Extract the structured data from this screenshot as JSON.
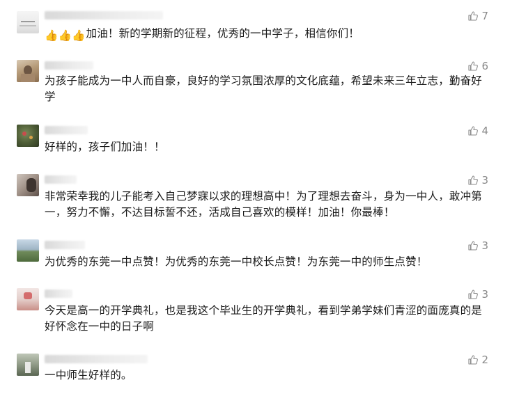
{
  "comments": [
    {
      "emoji_prefix": "👍👍👍",
      "text": "加油！新的学期新的征程，优秀的一中学子，相信你们！",
      "likes": "7"
    },
    {
      "text": "为孩子能成为一中人而自豪，良好的学习氛围浓厚的文化底蕴，希望未来三年立志，勤奋好学",
      "likes": "6"
    },
    {
      "text": "好样的，孩子们加油！！",
      "likes": "4"
    },
    {
      "text": "非常荣幸我的儿子能考入自己梦寐以求的理想高中！为了理想去奋斗，身为一中人，敢冲第一，努力不懈，不达目标誓不还，活成自己喜欢的模样！加油！你最棒！",
      "likes": "3"
    },
    {
      "text": "为优秀的东莞一中点赞！为优秀的东莞一中校长点赞！为东莞一中的师生点赞！",
      "likes": "3"
    },
    {
      "text": "今天是高一的开学典礼，也是我这个毕业生的开学典礼，看到学弟学妹们青涩的面庞真的是好怀念在一中的日子啊",
      "likes": "3"
    },
    {
      "text": "一中师生好样的。",
      "likes": "2"
    }
  ],
  "icons": {
    "like": "thumbs-up-outline-icon",
    "emoji": "thumbs-up-emoji-icon"
  },
  "colors": {
    "like_gray": "#8a8a8a",
    "text": "#1a1a1a"
  }
}
